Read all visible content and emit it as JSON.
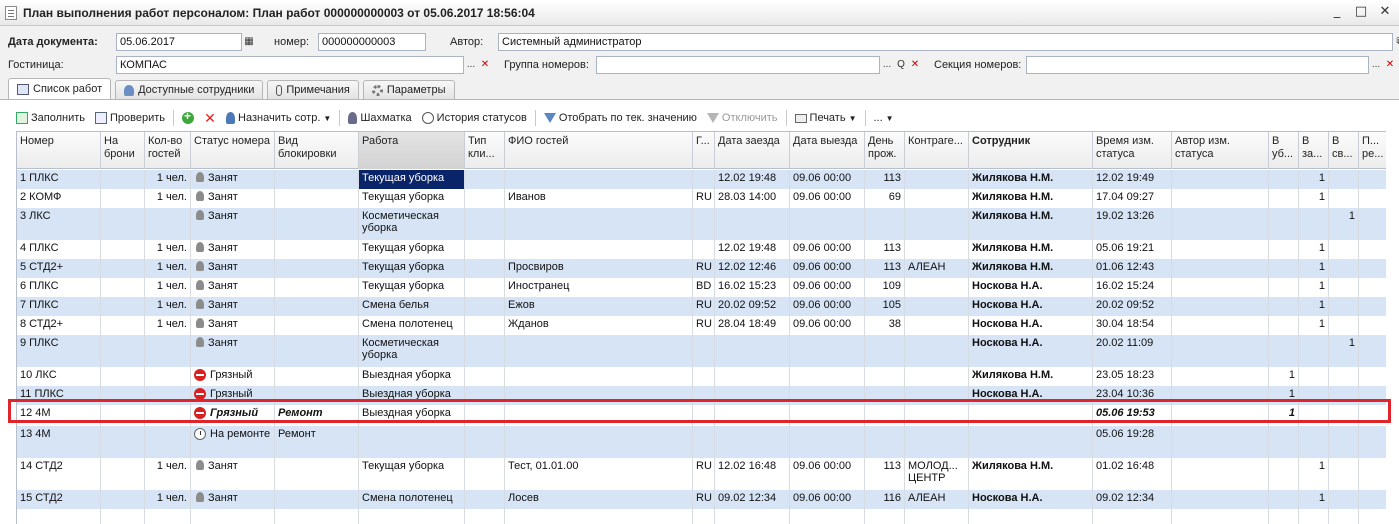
{
  "window": {
    "title": "План выполнения работ персоналом: План работ 000000000003 от 05.06.2017 18:56:04",
    "minimize": "_",
    "maximize": "□",
    "close": "✕"
  },
  "form": {
    "date_label": "Дата документа:",
    "date_value": "05.06.2017",
    "number_label": "номер:",
    "number_value": "000000000003",
    "author_label": "Автор:",
    "author_value": "Системный администратор",
    "hotel_label": "Гостиница:",
    "hotel_value": "КОМПАС",
    "room_group_label": "Группа номеров:",
    "room_group_value": "",
    "room_section_label": "Секция номеров:",
    "room_section_value": "",
    "btn_select": "...",
    "btn_clear": "✕",
    "btn_search": "Q"
  },
  "tabs": [
    {
      "label": "Список работ",
      "icon": "list-icon",
      "active": true
    },
    {
      "label": "Доступные сотрудники",
      "icon": "users-icon",
      "active": false
    },
    {
      "label": "Примечания",
      "icon": "paperclip-icon",
      "active": false
    },
    {
      "label": "Параметры",
      "icon": "gear-icon",
      "active": false
    }
  ],
  "toolbar": {
    "fill": "Заполнить",
    "check": "Проверить",
    "assign": "Назначить сотр.",
    "chess": "Шахматка",
    "history": "История статусов",
    "filter_by_value": "Отобрать по тек. значению",
    "disable": "Отключить",
    "print": "Печать",
    "more": "..."
  },
  "columns": [
    "Номер",
    "На брони",
    "Кол-во гостей",
    "Статус номера",
    "Вид блокировки",
    "Работа",
    "Тип кли...",
    "ФИО гостей",
    "Г...",
    "Дата заезда",
    "Дата выезда",
    "День прож.",
    "Контраге...",
    "Сотрудник",
    "Время изм. статуса",
    "Автор изм. статуса",
    "В уб...",
    "В за...",
    "В св...",
    "П... ре..."
  ],
  "rows": [
    {
      "num": "1 ПЛКС",
      "guests": "1 чел.",
      "status": "Занят",
      "status_icon": "busy",
      "block": "",
      "work": "Текущая уборка",
      "fio": "",
      "country": "",
      "arrival": "12.02 19:48",
      "departure": "09.06 00:00",
      "days": "113",
      "contractor": "",
      "employee": "Жилякова Н.М.",
      "changed": "12.02 19:49",
      "author": "",
      "c1": "",
      "c2": "1",
      "c3": "",
      "c4": ""
    },
    {
      "num": "2 КОМФ",
      "guests": "1 чел.",
      "status": "Занят",
      "status_icon": "busy",
      "block": "",
      "work": "Текущая уборка",
      "fio": "Иванов",
      "country": "RU",
      "arrival": "28.03 14:00",
      "departure": "09.06 00:00",
      "days": "69",
      "contractor": "",
      "employee": "Жилякова Н.М.",
      "changed": "17.04 09:27",
      "author": "",
      "c1": "",
      "c2": "1",
      "c3": "",
      "c4": ""
    },
    {
      "num": "3 ЛКС",
      "guests": "",
      "status": "Занят",
      "status_icon": "busy",
      "block": "",
      "work": "Косметическая уборка",
      "fio": "",
      "country": "",
      "arrival": "",
      "departure": "",
      "days": "",
      "contractor": "",
      "employee": "Жилякова Н.М.",
      "changed": "19.02 13:26",
      "author": "",
      "c1": "",
      "c2": "",
      "c3": "1",
      "c4": ""
    },
    {
      "num": "4 ПЛКС",
      "guests": "1 чел.",
      "status": "Занят",
      "status_icon": "busy",
      "block": "",
      "work": "Текущая уборка",
      "fio": "",
      "country": "",
      "arrival": "12.02 19:48",
      "departure": "09.06 00:00",
      "days": "113",
      "contractor": "",
      "employee": "Жилякова Н.М.",
      "changed": "05.06 19:21",
      "author": "",
      "c1": "",
      "c2": "1",
      "c3": "",
      "c4": ""
    },
    {
      "num": "5 СТД2+",
      "guests": "1 чел.",
      "status": "Занят",
      "status_icon": "busy",
      "block": "",
      "work": "Текущая уборка",
      "fio": "Просвиров",
      "country": "RU",
      "arrival": "12.02 12:46",
      "departure": "09.06 00:00",
      "days": "113",
      "contractor": "АЛЕАН",
      "employee": "Жилякова Н.М.",
      "changed": "01.06 12:43",
      "author": "",
      "c1": "",
      "c2": "1",
      "c3": "",
      "c4": ""
    },
    {
      "num": "6 ПЛКС",
      "guests": "1 чел.",
      "status": "Занят",
      "status_icon": "busy",
      "block": "",
      "work": "Текущая уборка",
      "fio": "Иностранец",
      "country": "BD",
      "arrival": "16.02 15:23",
      "departure": "09.06 00:00",
      "days": "109",
      "contractor": "",
      "employee": "Носкова Н.А.",
      "changed": "16.02 15:24",
      "author": "",
      "c1": "",
      "c2": "1",
      "c3": "",
      "c4": ""
    },
    {
      "num": "7 ПЛКС",
      "guests": "1 чел.",
      "status": "Занят",
      "status_icon": "busy",
      "block": "",
      "work": "Смена белья",
      "fio": "Ежов",
      "country": "RU",
      "arrival": "20.02 09:52",
      "departure": "09.06 00:00",
      "days": "105",
      "contractor": "",
      "employee": "Носкова Н.А.",
      "changed": "20.02 09:52",
      "author": "",
      "c1": "",
      "c2": "1",
      "c3": "",
      "c4": ""
    },
    {
      "num": "8 СТД2+",
      "guests": "1 чел.",
      "status": "Занят",
      "status_icon": "busy",
      "block": "",
      "work": "Смена полотенец",
      "fio": "Жданов",
      "country": "RU",
      "arrival": "28.04 18:49",
      "departure": "09.06 00:00",
      "days": "38",
      "contractor": "",
      "employee": "Носкова Н.А.",
      "changed": "30.04 18:54",
      "author": "",
      "c1": "",
      "c2": "1",
      "c3": "",
      "c4": ""
    },
    {
      "num": "9 ПЛКС",
      "guests": "",
      "status": "Занят",
      "status_icon": "busy",
      "block": "",
      "work": "Косметическая уборка",
      "fio": "",
      "country": "",
      "arrival": "",
      "departure": "",
      "days": "",
      "contractor": "",
      "employee": "Носкова Н.А.",
      "changed": "20.02 11:09",
      "author": "",
      "c1": "",
      "c2": "",
      "c3": "1",
      "c4": ""
    },
    {
      "num": "10 ЛКС",
      "guests": "",
      "status": "Грязный",
      "status_icon": "dirty",
      "block": "",
      "work": "Выездная уборка",
      "fio": "",
      "country": "",
      "arrival": "",
      "departure": "",
      "days": "",
      "contractor": "",
      "employee": "Жилякова Н.М.",
      "changed": "23.05 18:23",
      "author": "",
      "c1": "1",
      "c2": "",
      "c3": "",
      "c4": ""
    },
    {
      "num": "11 ПЛКС",
      "guests": "",
      "status": "Грязный",
      "status_icon": "dirty",
      "block": "",
      "work": "Выездная уборка",
      "fio": "",
      "country": "",
      "arrival": "",
      "departure": "",
      "days": "",
      "contractor": "",
      "employee": "Носкова Н.А.",
      "changed": "23.04 10:36",
      "author": "",
      "c1": "1",
      "c2": "",
      "c3": "",
      "c4": ""
    },
    {
      "num": "12 4М",
      "guests": "",
      "status": "Грязный",
      "status_icon": "dirty",
      "block": "Ремонт",
      "work": "Выездная уборка",
      "fio": "",
      "country": "",
      "arrival": "",
      "departure": "",
      "days": "",
      "contractor": "",
      "employee": "",
      "changed": "05.06 19:53",
      "author": "",
      "c1": "1",
      "c2": "",
      "c3": "",
      "c4": ""
    },
    {
      "num": "13 4М",
      "guests": "",
      "status": "На ремонте",
      "status_icon": "repair",
      "block": "Ремонт",
      "work": "",
      "fio": "",
      "country": "",
      "arrival": "",
      "departure": "",
      "days": "",
      "contractor": "",
      "employee": "",
      "changed": "05.06 19:28",
      "author": "",
      "c1": "",
      "c2": "",
      "c3": "",
      "c4": ""
    },
    {
      "num": "14 СТД2",
      "guests": "1 чел.",
      "status": "Занят",
      "status_icon": "busy",
      "block": "",
      "work": "Текущая уборка",
      "fio": "Тест, 01.01.00",
      "country": "RU",
      "arrival": "12.02 16:48",
      "departure": "09.06 00:00",
      "days": "113",
      "contractor": "МОЛОД... ЦЕНТР",
      "employee": "Жилякова Н.М.",
      "changed": "01.02 16:48",
      "author": "",
      "c1": "",
      "c2": "1",
      "c3": "",
      "c4": ""
    },
    {
      "num": "15 СТД2",
      "guests": "1 чел.",
      "status": "Занят",
      "status_icon": "busy",
      "block": "",
      "work": "Смена полотенец",
      "fio": "Лосев",
      "country": "RU",
      "arrival": "09.02 12:34",
      "departure": "09.06 00:00",
      "days": "116",
      "contractor": "АЛЕАН",
      "employee": "Носкова Н.А.",
      "changed": "09.02 12:34",
      "author": "",
      "c1": "",
      "c2": "1",
      "c3": "",
      "c4": ""
    }
  ]
}
